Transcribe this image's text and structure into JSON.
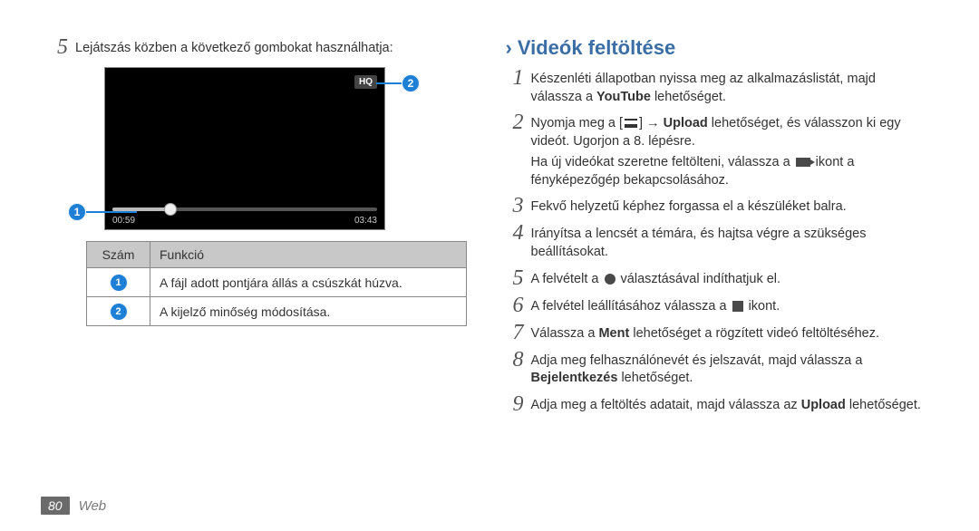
{
  "left": {
    "step5_text": "Lejátszás közben a következő gombokat használhatja:",
    "video": {
      "hq": "HQ",
      "time_left": "00:59",
      "time_right": "03:43"
    },
    "table": {
      "h_num": "Szám",
      "h_func": "Funkció",
      "rows": [
        {
          "n": "1",
          "f": "A fájl adott pontjára állás a csúszkát húzva."
        },
        {
          "n": "2",
          "f": "A kijelző minőség módosítása."
        }
      ]
    }
  },
  "right": {
    "title": "Videók feltöltése",
    "s1_a": "Készenléti állapotban nyissa meg az alkalmazáslistát, majd válassza a ",
    "s1_b": "YouTube",
    "s1_c": " lehetőséget.",
    "s2_a": "Nyomja meg a [",
    "s2_b": "] → ",
    "s2_c": "Upload",
    "s2_d": " lehetőséget, és válasszon ki egy videót. Ugorjon a 8. lépésre.",
    "s2_note_a": "Ha új videókat szeretne feltölteni, válassza a ",
    "s2_note_b": " ikont a fényképezőgép bekapcsolásához.",
    "s3": "Fekvő helyzetű képhez forgassa el a készüléket balra.",
    "s4": "Irányítsa a lencsét a témára, és hajtsa végre a szükséges beállításokat.",
    "s5_a": "A felvételt a ",
    "s5_b": " választásával indíthatjuk el.",
    "s6_a": "A felvétel leállításához válassza a ",
    "s6_b": " ikont.",
    "s7_a": "Válassza a ",
    "s7_b": "Ment",
    "s7_c": " lehetőséget a rögzített videó feltöltéséhez.",
    "s8_a": "Adja meg felhasználónevét és jelszavát, majd válassza a ",
    "s8_b": "Bejelentkezés",
    "s8_c": " lehetőséget.",
    "s9_a": "Adja meg a feltöltés adatait, majd válassza az ",
    "s9_b": "Upload",
    "s9_c": " lehetőséget."
  },
  "footer": {
    "page": "80",
    "section": "Web"
  }
}
